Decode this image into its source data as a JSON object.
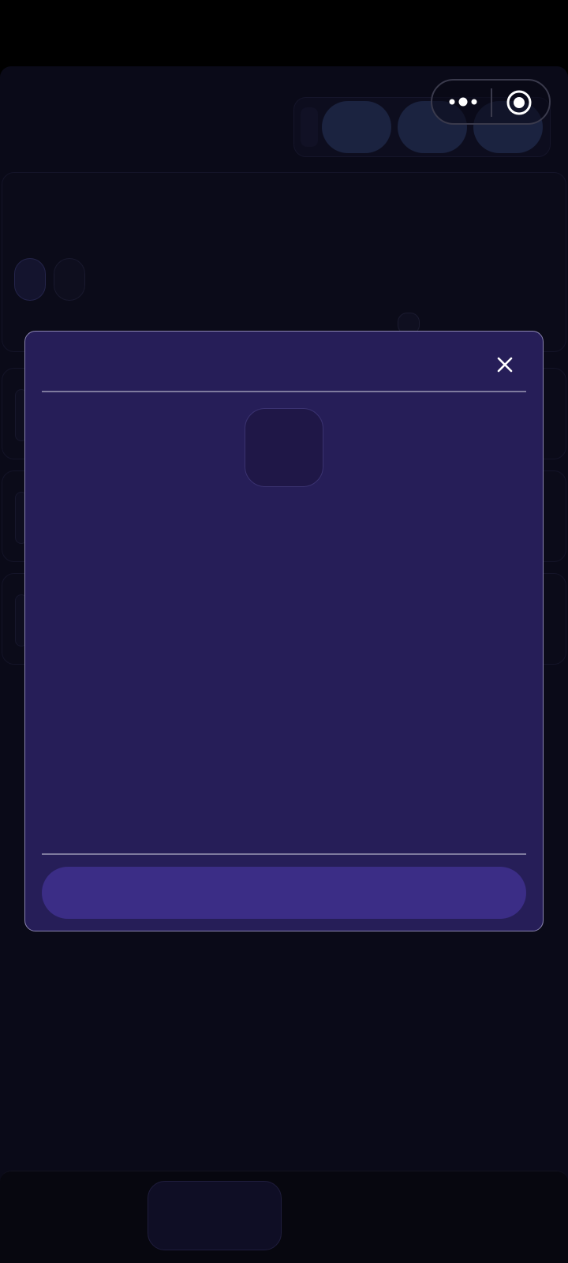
{
  "capsule": {
    "more_icon": "more-dots-icon",
    "close_icon": "target-circle-icon"
  },
  "modal": {
    "title": "",
    "close_icon": "close-x-icon",
    "body_text": "",
    "primary_button_label": ""
  },
  "colors": {
    "page_background": "#0a0a18",
    "modal_background": "#261e58",
    "modal_border": "#8a84b0",
    "primary_button": "#3b2d86",
    "pill": "#1b2340"
  }
}
